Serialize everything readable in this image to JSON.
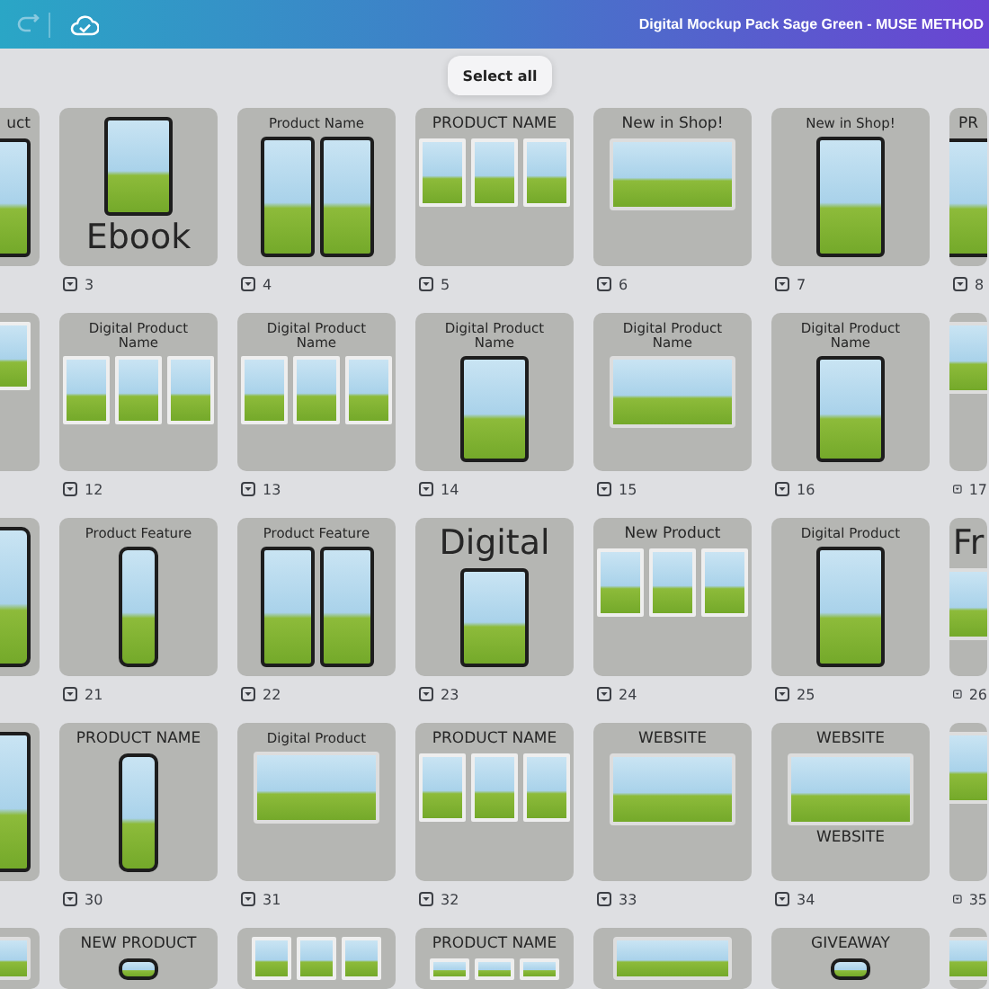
{
  "top_bar": {
    "title": "Digital Mockup Pack Sage Green - MUSE METHOD"
  },
  "select_all": "Select all",
  "rows": [
    {
      "pages": [
        {
          "parts": [
            {
              "kind": "heading_medium",
              "text": "uct"
            },
            {
              "kind": "tablet"
            }
          ]
        },
        {
          "number": "3",
          "parts": [
            {
              "kind": "tablet"
            },
            {
              "kind": "heading_large",
              "text": "Ebook"
            }
          ]
        },
        {
          "number": "4",
          "parts": [
            {
              "kind": "heading_small",
              "text": "Product Name"
            },
            {
              "kind": "tablets"
            }
          ]
        },
        {
          "number": "5",
          "parts": [
            {
              "kind": "heading_medium",
              "text": "PRODUCT NAME"
            },
            {
              "kind": "screens"
            }
          ]
        },
        {
          "number": "6",
          "parts": [
            {
              "kind": "heading_medium",
              "text": "New in Shop!"
            },
            {
              "kind": "landscape"
            }
          ]
        },
        {
          "number": "7",
          "parts": [
            {
              "kind": "heading_small",
              "text": "New in Shop!"
            },
            {
              "kind": "tablet"
            }
          ]
        },
        {
          "number": "8",
          "parts": [
            {
              "kind": "heading_medium",
              "text": "PR"
            },
            {
              "kind": "tablet"
            }
          ]
        }
      ]
    },
    {
      "pages": [
        {
          "parts": [
            {
              "kind": "screens"
            }
          ]
        },
        {
          "number": "12",
          "parts": [
            {
              "kind": "heading_small",
              "text": "Digital Product Name"
            },
            {
              "kind": "screens"
            }
          ]
        },
        {
          "number": "13",
          "parts": [
            {
              "kind": "heading_small",
              "text": "Digital Product Name"
            },
            {
              "kind": "screens"
            }
          ]
        },
        {
          "number": "14",
          "parts": [
            {
              "kind": "heading_small",
              "text": "Digital Product Name"
            },
            {
              "kind": "tablet"
            }
          ]
        },
        {
          "number": "15",
          "parts": [
            {
              "kind": "heading_small",
              "text": "Digital Product Name"
            },
            {
              "kind": "landscape"
            }
          ]
        },
        {
          "number": "16",
          "parts": [
            {
              "kind": "heading_small",
              "text": "Digital Product Name"
            },
            {
              "kind": "tablet"
            }
          ]
        },
        {
          "number": "17",
          "parts": [
            {
              "kind": "landscape"
            }
          ]
        }
      ]
    },
    {
      "pages": [
        {
          "parts": [
            {
              "kind": "phone"
            }
          ]
        },
        {
          "number": "21",
          "parts": [
            {
              "kind": "heading_small",
              "text": "Product Feature"
            },
            {
              "kind": "phone"
            }
          ]
        },
        {
          "number": "22",
          "parts": [
            {
              "kind": "heading_small",
              "text": "Product Feature"
            },
            {
              "kind": "tablets"
            }
          ]
        },
        {
          "number": "23",
          "parts": [
            {
              "kind": "heading_large",
              "text": "Digital"
            },
            {
              "kind": "tablet"
            }
          ]
        },
        {
          "number": "24",
          "parts": [
            {
              "kind": "heading_medium",
              "text": "New Product"
            },
            {
              "kind": "screens"
            }
          ]
        },
        {
          "number": "25",
          "parts": [
            {
              "kind": "heading_small",
              "text": "Digital Product"
            },
            {
              "kind": "tablet"
            }
          ]
        },
        {
          "number": "26",
          "parts": [
            {
              "kind": "heading_large",
              "text": "Fr"
            },
            {
              "kind": "landscape"
            }
          ]
        }
      ]
    },
    {
      "pages": [
        {
          "parts": [
            {
              "kind": "tablet"
            }
          ]
        },
        {
          "number": "30",
          "parts": [
            {
              "kind": "heading_medium",
              "text": "PRODUCT NAME"
            },
            {
              "kind": "phone"
            }
          ]
        },
        {
          "number": "31",
          "parts": [
            {
              "kind": "heading_small",
              "text": "Digital Product"
            },
            {
              "kind": "landscape"
            }
          ]
        },
        {
          "number": "32",
          "parts": [
            {
              "kind": "heading_medium",
              "text": "PRODUCT NAME"
            },
            {
              "kind": "screens"
            }
          ]
        },
        {
          "number": "33",
          "parts": [
            {
              "kind": "heading_medium",
              "text": "WEBSITE"
            },
            {
              "kind": "landscape"
            }
          ]
        },
        {
          "number": "34",
          "parts": [
            {
              "kind": "heading_medium",
              "text": "WEBSITE"
            },
            {
              "kind": "landscape"
            },
            {
              "kind": "heading_medium",
              "text": "WEBSITE"
            }
          ]
        },
        {
          "number": "35",
          "parts": [
            {
              "kind": "landscape"
            }
          ]
        }
      ]
    },
    {
      "pages": [
        {
          "parts": [
            {
              "kind": "landscape"
            }
          ]
        },
        {
          "parts": [
            {
              "kind": "heading_medium",
              "text": "NEW PRODUCT"
            },
            {
              "kind": "phone"
            }
          ]
        },
        {
          "parts": [
            {
              "kind": "screens"
            }
          ]
        },
        {
          "parts": [
            {
              "kind": "heading_medium",
              "text": "PRODUCT NAME"
            },
            {
              "kind": "screens"
            }
          ]
        },
        {
          "parts": [
            {
              "kind": "landscape"
            }
          ]
        },
        {
          "parts": [
            {
              "kind": "heading_medium",
              "text": "GIVEAWAY"
            },
            {
              "kind": "phone"
            }
          ]
        },
        {
          "parts": [
            {
              "kind": "landscape"
            }
          ]
        }
      ]
    }
  ]
}
